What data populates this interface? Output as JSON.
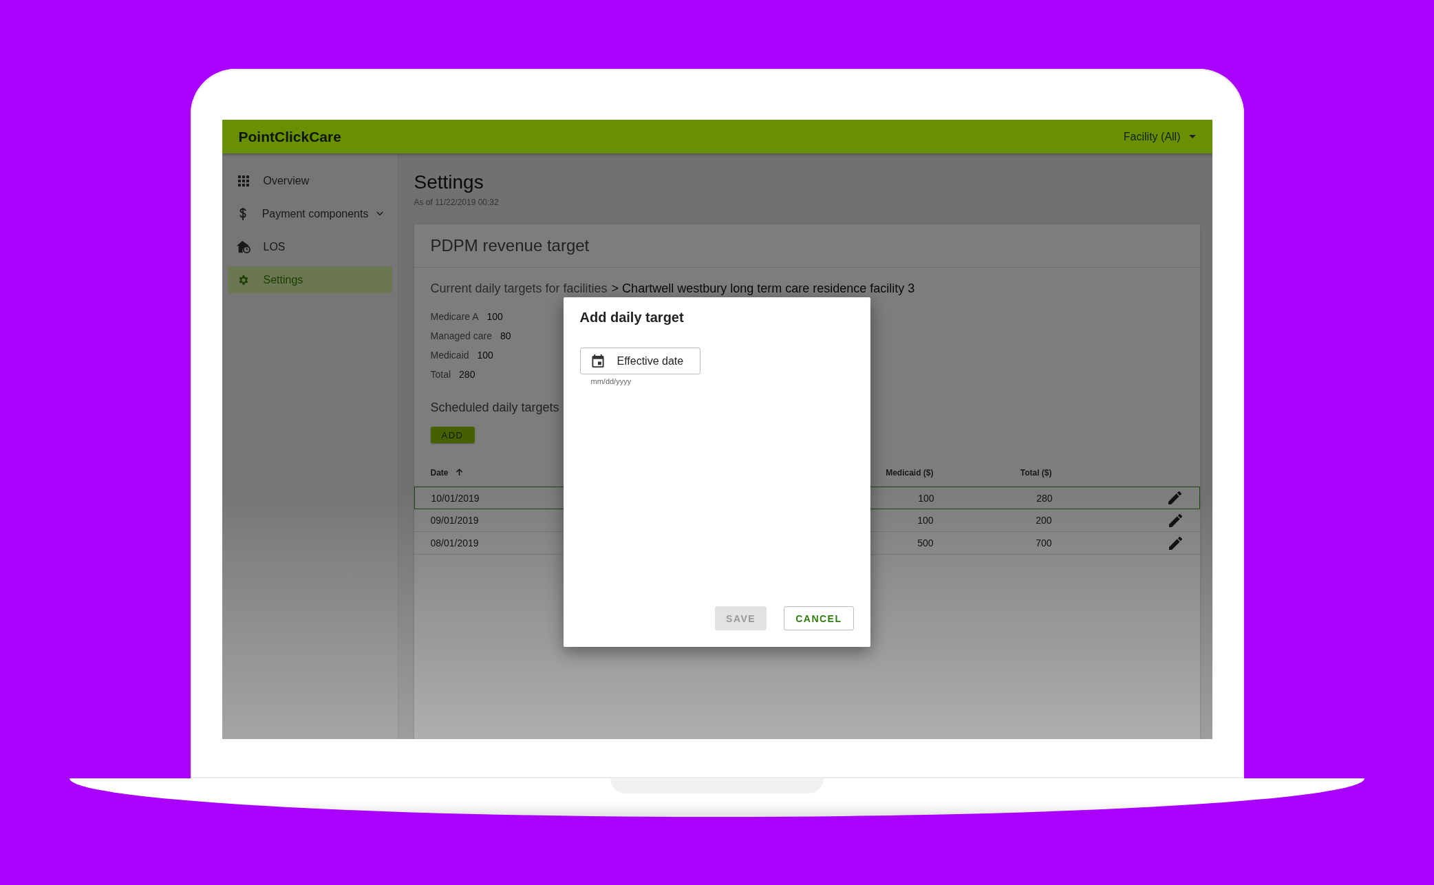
{
  "header": {
    "logo": "PointClickCare",
    "facility_menu": "Facility (All)"
  },
  "sidebar": {
    "items": [
      {
        "label": "Overview",
        "selected": false,
        "expandable": false
      },
      {
        "label": "Payment components",
        "selected": false,
        "expandable": true
      },
      {
        "label": "LOS",
        "selected": false,
        "expandable": false
      },
      {
        "label": "Settings",
        "selected": true,
        "expandable": false
      }
    ]
  },
  "page": {
    "title": "Settings",
    "as_of": "As of 11/22/2019 00:32"
  },
  "card": {
    "title": "PDPM revenue target",
    "breadcrumb_prefix": "Current daily targets for facilities",
    "breadcrumb_current": "> Chartwell westbury long term care residence facility 3",
    "current_targets": [
      {
        "label": "Medicare A",
        "value": "100"
      },
      {
        "label": "Managed care",
        "value": "80"
      },
      {
        "label": "Medicaid",
        "value": "100"
      },
      {
        "label": "Total",
        "value": "280"
      }
    ],
    "scheduled_title": "Scheduled daily targets",
    "add_button": "ADD",
    "table": {
      "columns": [
        {
          "label": "Date",
          "sorted": true
        },
        {
          "label": "Medicaid ($)",
          "sorted": false
        },
        {
          "label": "Total ($)",
          "sorted": false
        }
      ],
      "rows": [
        {
          "date": "10/01/2019",
          "medicaid": "100",
          "total": "280",
          "selected": true
        },
        {
          "date": "09/01/2019",
          "medicaid": "100",
          "total": "200",
          "selected": false
        },
        {
          "date": "08/01/2019",
          "medicaid": "500",
          "total": "700",
          "selected": false
        }
      ]
    }
  },
  "dialog": {
    "title": "Add daily target",
    "date_field": {
      "placeholder": "Effective date",
      "helper": "mm/dd/yyyy"
    },
    "buttons": [
      {
        "label": "SAVE",
        "disabled": true
      },
      {
        "label": "CANCEL",
        "disabled": false
      }
    ]
  }
}
